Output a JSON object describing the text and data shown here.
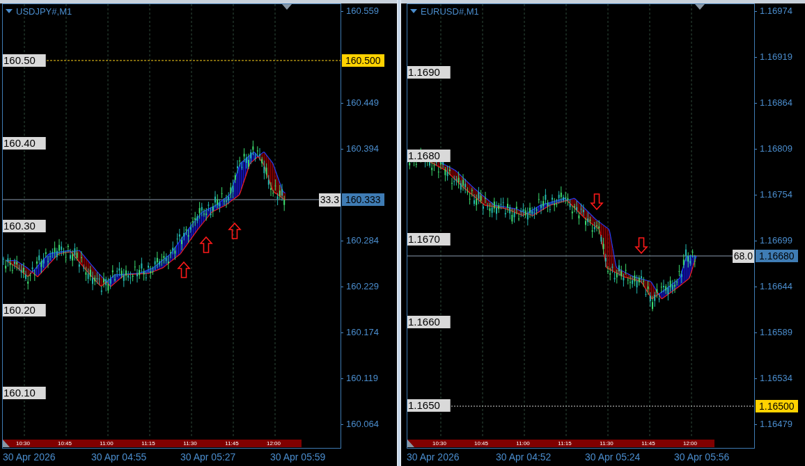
{
  "charts": [
    {
      "title": "USDJPY#,M1",
      "price_axis": [
        "160.559",
        "160.449",
        "160.394",
        "160.284",
        "160.229",
        "160.174",
        "160.119",
        "160.064"
      ],
      "markers": [
        {
          "kind": "alert",
          "label": "160.500"
        },
        {
          "kind": "bid",
          "label": "160.333"
        }
      ],
      "readout": "33.3",
      "levels": [
        "160.50",
        "160.40",
        "160.30",
        "160.20",
        "160.10"
      ],
      "session_bar": [
        "10:30",
        "10:45",
        "11:00",
        "11:15",
        "11:30",
        "11:45",
        "12:00"
      ],
      "time_axis": [
        "30 Apr 2026",
        "30 Apr 04:55",
        "30 Apr 05:27",
        "30 Apr 05:59"
      ],
      "arrows": [
        {
          "kind": "up"
        },
        {
          "kind": "up"
        },
        {
          "kind": "up"
        }
      ]
    },
    {
      "title": "EURUSD#,M1",
      "price_axis": [
        "1.16974",
        "1.16919",
        "1.16864",
        "1.16809",
        "1.16754",
        "1.16699",
        "1.16644",
        "1.16589",
        "1.16534",
        "1.16479"
      ],
      "markers": [
        {
          "kind": "bid",
          "label": "1.16680"
        },
        {
          "kind": "alert",
          "label": "1.16500"
        }
      ],
      "readout": "68.0",
      "levels": [
        "1.1690",
        "1.1680",
        "1.1670",
        "1.1660",
        "1.1650"
      ],
      "session_bar": [
        "10:30",
        "10:45",
        "11:00",
        "11:15",
        "11:30",
        "11:45",
        "12:00"
      ],
      "time_axis": [
        "30 Apr 2026",
        "30 Apr 04:52",
        "30 Apr 05:24",
        "30 Apr 05:56"
      ],
      "arrows": [
        {
          "kind": "down"
        },
        {
          "kind": "down"
        }
      ]
    }
  ]
}
